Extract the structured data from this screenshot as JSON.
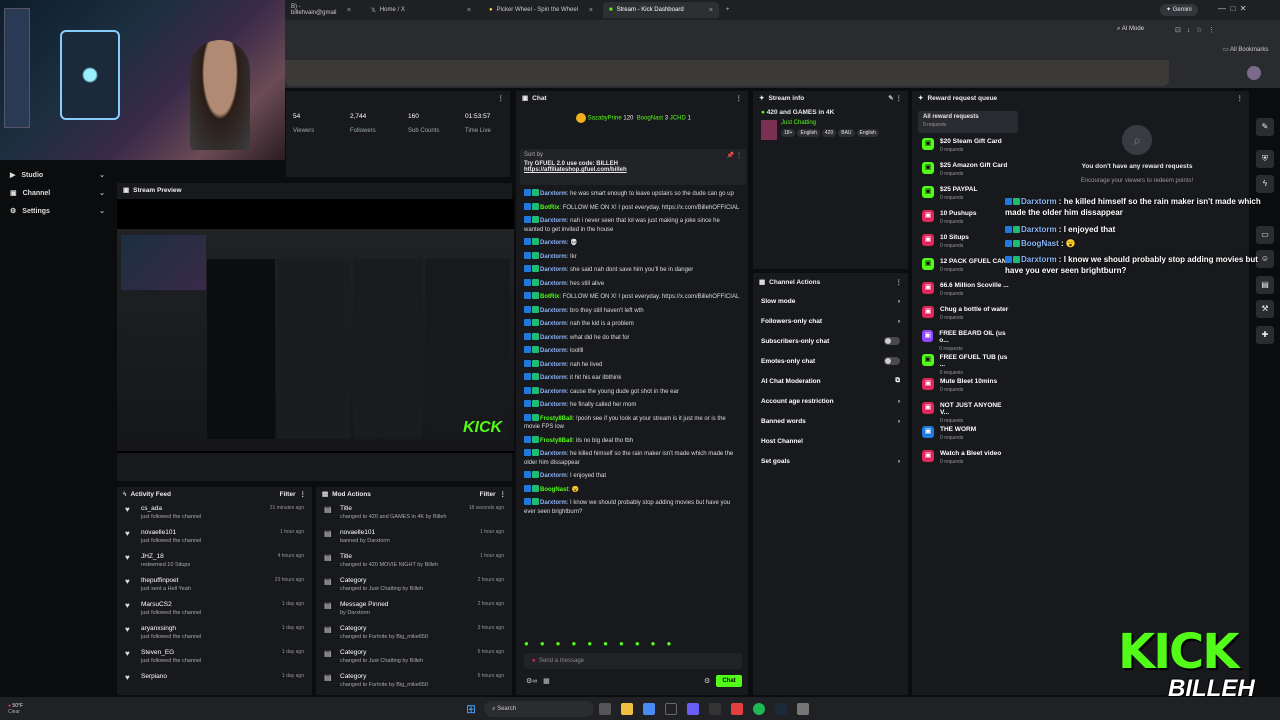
{
  "browser": {
    "tabs": [
      {
        "label": "B) - billehvain@gmail",
        "active": false
      },
      {
        "label": "Home / X",
        "active": false
      },
      {
        "label": "Picker Wheel - Spin the Wheel",
        "active": false
      },
      {
        "label": "Stream - Kick Dashboard",
        "active": true
      }
    ],
    "new_tab": "+",
    "gemini_label": "Gemini",
    "ai_mode_label": "AI Mode",
    "bookmarks_label": "All Bookmarks"
  },
  "sidebar": {
    "items": [
      {
        "label": "Studio",
        "icon": "studio-icon"
      },
      {
        "label": "Channel",
        "icon": "channel-icon"
      },
      {
        "label": "Settings",
        "icon": "gear-icon"
      }
    ]
  },
  "stats": [
    {
      "value": "54",
      "label": "Viewers"
    },
    {
      "value": "2,744",
      "label": "Followers"
    },
    {
      "value": "160",
      "label": "Sub Counts"
    },
    {
      "value": "01:53:57",
      "label": "Time Live"
    }
  ],
  "stream_preview": {
    "title": "Stream Preview"
  },
  "activity_feed": {
    "title": "Activity Feed",
    "filter_label": "Filter",
    "items": [
      {
        "name": "cs_ada",
        "sub": "just followed the channel",
        "time": "31 minutes ago"
      },
      {
        "name": "novaelle101",
        "sub": "just followed the channel",
        "time": "1 hour ago"
      },
      {
        "name": "JHZ_18",
        "sub": "redeemed 10 Situps",
        "time": "4 hours ago"
      },
      {
        "name": "thepuffinpoet",
        "sub": "just sent a Hell Yeah",
        "time": "23 hours ago"
      },
      {
        "name": "MarsuCS2",
        "sub": "just followed the channel",
        "time": "1 day ago"
      },
      {
        "name": "aryanxsingh",
        "sub": "just followed the channel",
        "time": "1 day ago"
      },
      {
        "name": "Steven_EG",
        "sub": "just followed the channel",
        "time": "1 day ago"
      },
      {
        "name": "Serpiano",
        "sub": "",
        "time": "1 day ago"
      }
    ]
  },
  "mod_actions": {
    "title": "Mod Actions",
    "filter_label": "Filter",
    "items": [
      {
        "name": "Title",
        "sub": "changed to 420 and GAMES in 4K by Billeh",
        "time": "18 seconds ago"
      },
      {
        "name": "novaelle101",
        "sub": "banned by Darxtorm",
        "time": "1 hour ago"
      },
      {
        "name": "Title",
        "sub": "changed to 420 MOVIE NIGHT by Billeh",
        "time": "1 hour ago"
      },
      {
        "name": "Category",
        "sub": "changed to Just Chatting by Billeh",
        "time": "2 hours ago"
      },
      {
        "name": "Message Pinned",
        "sub": "by Darxtorm",
        "time": "2 hours ago"
      },
      {
        "name": "Category",
        "sub": "changed to Fortnite by Big_mike650",
        "time": "3 hours ago"
      },
      {
        "name": "Category",
        "sub": "changed to Just Chatting by Billeh",
        "time": "5 hours ago"
      },
      {
        "name": "Category",
        "sub": "changed to Fortnite by Big_mike650",
        "time": "6 hours ago"
      }
    ]
  },
  "chat": {
    "title": "Chat",
    "top_users": [
      {
        "name": "SazabyPrine",
        "count": "120"
      },
      {
        "name": "BoogNast",
        "count": "3"
      },
      {
        "name": "JCHD",
        "count": "1"
      }
    ],
    "pinned": {
      "sort": "Sort by",
      "text": "Try GFUEL 2.0 use code: BILLEH",
      "link": "https://affiliateshop.gfuel.com/billeh"
    },
    "messages": [
      {
        "user": "Darxtorm",
        "text": "he was smart enough to leave upstairs so the dude can go up"
      },
      {
        "user": "BotRix",
        "text": "FOLLOW ME ON X! I post everyday. https://x.com/BillehOFFICIAL"
      },
      {
        "user": "Darxtorm",
        "text": "nah i never seen that lol was just making a joke since he wanted to get invited in the house"
      },
      {
        "user": "Darxtorm",
        "text": "💀"
      },
      {
        "user": "Darxtorm",
        "text": "Ikr"
      },
      {
        "user": "Darxtorm",
        "text": "she said nah dont save him you'll be in danger"
      },
      {
        "user": "Darxtorm",
        "text": "hes still alive"
      },
      {
        "user": "BotRix",
        "text": "FOLLOW ME ON X! I post everyday. https://x.com/BillehOFFICIAL"
      },
      {
        "user": "Darxtorm",
        "text": "bro they still haven't left wth"
      },
      {
        "user": "Darxtorm",
        "text": "nah the kid is a problem"
      },
      {
        "user": "Darxtorm",
        "text": "what did he do that for"
      },
      {
        "user": "Darxtorm",
        "text": "loollll"
      },
      {
        "user": "Darxtorm",
        "text": "nah he lived"
      },
      {
        "user": "Darxtorm",
        "text": "it hit his ear itbthink"
      },
      {
        "user": "Darxtorm",
        "text": "cause the young dude got shot in the ear"
      },
      {
        "user": "Darxtorm",
        "text": "he finally called her mom"
      },
      {
        "user": "Frosty8Ball",
        "text": "!pooh see if you look at your stream is it just me or is the movie FPS low"
      },
      {
        "user": "Frosty8Ball",
        "text": "its no big deal tho tbh"
      },
      {
        "user": "Darxtorm",
        "text": "he killed himself so the rain maker isn't made which made the older him dissappear"
      },
      {
        "user": "Darxtorm",
        "text": "I enjoyed that"
      },
      {
        "user": "BoogNast",
        "text": "😮"
      },
      {
        "user": "Darxtorm",
        "text": "I know we should probably stop adding movies but have you ever seen brightburn?"
      }
    ],
    "input_placeholder": "Send a message",
    "send_label": "Chat"
  },
  "stream_info": {
    "title": "Stream info",
    "stream_title": "420 and GAMES in 4K",
    "category": "Just Chatting",
    "tags": [
      "18+",
      "English",
      "420",
      "BAU",
      "English"
    ]
  },
  "channel_actions": {
    "title": "Channel Actions",
    "items": [
      {
        "label": "Slow mode",
        "control": "chevron"
      },
      {
        "label": "Followers-only chat",
        "control": "chevron"
      },
      {
        "label": "Subscribers-only chat",
        "control": "toggle"
      },
      {
        "label": "Emotes-only chat",
        "control": "toggle"
      },
      {
        "label": "AI Chat Moderation",
        "control": "external"
      },
      {
        "label": "Account age restriction",
        "control": "chevron"
      },
      {
        "label": "Banned words",
        "control": "chevron"
      },
      {
        "label": "Host Channel",
        "control": "none"
      },
      {
        "label": "Set goals",
        "control": "chevron"
      }
    ]
  },
  "reward_queue": {
    "title": "Reward request queue",
    "all_label": "All reward requests",
    "all_sub": "0 requests",
    "empty_title": "You don't have any reward requests",
    "empty_sub": "Encourage your viewers to redeem points!",
    "items": [
      {
        "name": "$20 Steam Gift Card",
        "sub": "0 requests",
        "color": "green"
      },
      {
        "name": "$25 Amazon Gift Card",
        "sub": "0 requests",
        "color": "green"
      },
      {
        "name": "$25 PAYPAL",
        "sub": "0 requests",
        "color": "green"
      },
      {
        "name": "10 Pushups",
        "sub": "0 requests",
        "color": "red"
      },
      {
        "name": "10 Situps",
        "sub": "0 requests",
        "color": "red"
      },
      {
        "name": "12 PACK GFUEL CANS",
        "sub": "0 requests",
        "color": "green"
      },
      {
        "name": "66.6 Million Scoville ...",
        "sub": "0 requests",
        "color": "red"
      },
      {
        "name": "Chug a bottle of water",
        "sub": "0 requests",
        "color": "red"
      },
      {
        "name": "FREE BEARD OIL (us o...",
        "sub": "0 requests",
        "color": "purple"
      },
      {
        "name": "FREE GFUEL TUB (us ...",
        "sub": "0 requests",
        "color": "green"
      },
      {
        "name": "Mute Bleet 10mins",
        "sub": "0 requests",
        "color": "red"
      },
      {
        "name": "NOT JUST ANYONE V...",
        "sub": "0 requests",
        "color": "red"
      },
      {
        "name": "THE WORM",
        "sub": "0 requests",
        "color": "blue"
      },
      {
        "name": "Watch a Bleet video",
        "sub": "0 requests",
        "color": "red"
      }
    ]
  },
  "overlay_chat": [
    {
      "user": "Darxtorm",
      "text": "he killed himself so the rain maker isn't made which made the older him dissappear"
    },
    {
      "user": "Darxtorm",
      "text": "I enjoyed that"
    },
    {
      "user": "BoogNast",
      "text": "😮"
    },
    {
      "user": "Darxtorm",
      "text": "I know we should probably stop adding movies but have you ever seen brightburn?"
    }
  ],
  "overlay_logo": {
    "line1": "KICK",
    "line2": "BILLEH"
  },
  "taskbar": {
    "weather_temp": "50°F",
    "weather_desc": "Clear",
    "search_label": "Search"
  },
  "colors": {
    "accent": "#53fc18",
    "panel": "#18191c",
    "bg": "#0b0c0d"
  }
}
